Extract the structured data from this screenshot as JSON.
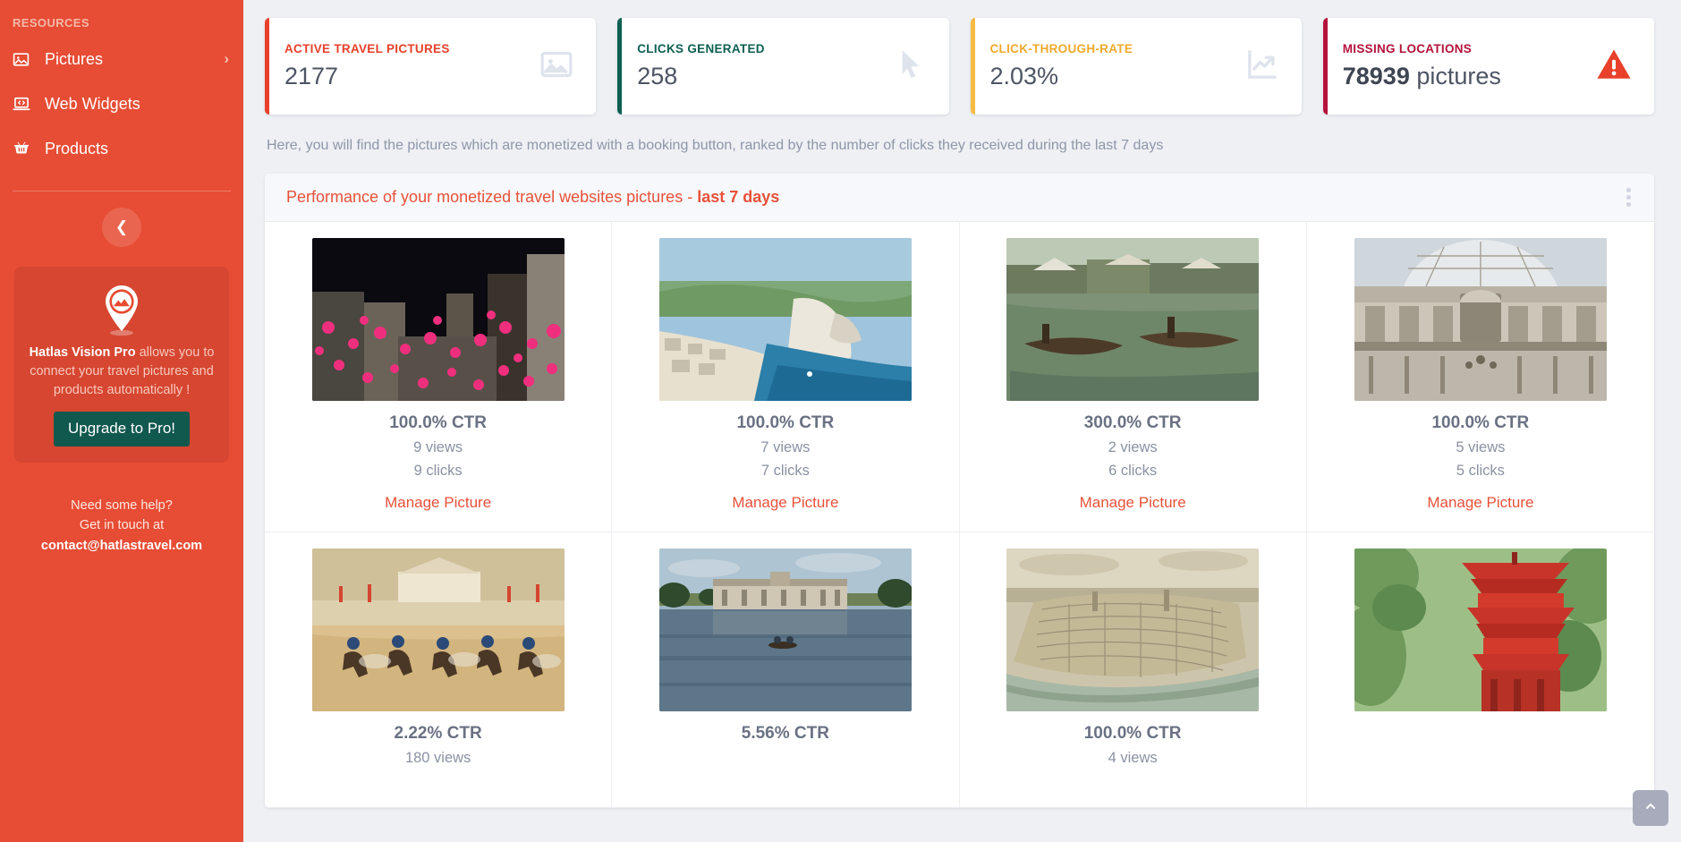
{
  "sidebar": {
    "section_title": "RESOURCES",
    "items": [
      {
        "label": "Pictures",
        "icon": "image-icon",
        "has_chevron": true
      },
      {
        "label": "Web Widgets",
        "icon": "laptop-code-icon",
        "has_chevron": false
      },
      {
        "label": "Products",
        "icon": "basket-icon",
        "has_chevron": false
      }
    ],
    "collapse_icon": "chevron-left-icon",
    "promo": {
      "logo_icon": "map-pin-mountain-logo",
      "brand": "Hatlas Vision Pro",
      "text": " allows you to connect your travel pictures and products automatically !",
      "button_label": "Upgrade to Pro!",
      "button_color": "#11584f"
    },
    "help": {
      "line1": "Need some help?",
      "line2": "Get in touch at",
      "email": "contact@hatlastravel.com"
    },
    "bg_color": "#e74c34"
  },
  "kpis": [
    {
      "label": "ACTIVE TRAVEL PICTURES",
      "value": "2177",
      "suffix": "",
      "accent": "#e8402a",
      "icon": "image-icon"
    },
    {
      "label": "CLICKS GENERATED",
      "value": "258",
      "suffix": "",
      "accent": "#0d5f52",
      "icon": "cursor-arrow-icon"
    },
    {
      "label": "CLICK-THROUGH-RATE",
      "value": "2.03%",
      "suffix": "",
      "accent": "#f6bb42",
      "icon": "line-chart-up-icon"
    },
    {
      "label": "MISSING LOCATIONS",
      "value": "78939",
      "suffix": "pictures",
      "accent": "#b4123c",
      "icon": "warning-triangle-icon"
    }
  ],
  "intro": "Here, you will find the pictures which are monetized with a booking button, ranked by the number of clicks they received during the last 7 days",
  "panel": {
    "title_plain": "Performance of your monetized travel websites pictures - ",
    "title_bold": "last 7 days",
    "menu_icon": "kebab-menu-icon"
  },
  "pictures": [
    {
      "ctr": "100.0% CTR",
      "views": "9 views",
      "clicks": "9 clicks",
      "link": "Manage Picture",
      "scene": "pink-lanterns-night-street"
    },
    {
      "ctr": "100.0% CTR",
      "views": "7 views",
      "clicks": "7 clicks",
      "link": "Manage Picture",
      "scene": "etretat-cliffs-beach"
    },
    {
      "ctr": "300.0% CTR",
      "views": "2 views",
      "clicks": "6 clicks",
      "link": "Manage Picture",
      "scene": "floating-village-boats"
    },
    {
      "ctr": "100.0% CTR",
      "views": "5 views",
      "clicks": "5 clicks",
      "link": "Manage Picture",
      "scene": "glass-arcade-gallery"
    },
    {
      "ctr": "2.22% CTR",
      "views": "180 views",
      "clicks": "",
      "link": "",
      "scene": "desert-horse-riders"
    },
    {
      "ctr": "5.56% CTR",
      "views": "",
      "clicks": "",
      "link": "",
      "scene": "chateau-lake-reflection"
    },
    {
      "ctr": "100.0% CTR",
      "views": "4 views",
      "clicks": "",
      "link": "",
      "scene": "vintage-city-map-aerial"
    },
    {
      "ctr": "",
      "views": "",
      "clicks": "",
      "link": "",
      "scene": "red-pagoda-trees"
    }
  ],
  "to_top": {
    "icon": "chevron-up-icon"
  }
}
